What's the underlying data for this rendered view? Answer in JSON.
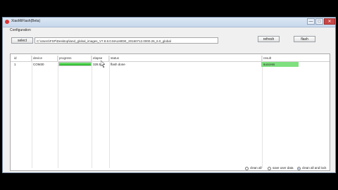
{
  "window": {
    "title": "XiaoMiFlash(Beta)",
    "min_glyph": "—",
    "max_glyph": "□",
    "close_glyph": "✕"
  },
  "config": {
    "label": "Configuration",
    "select_label": "select",
    "path_value": "C:\\Users\\FSP\\Desktop\\land_global_images_V7.8.8.0.MALMIDE_20160712.0000.26_6.0_global",
    "refresh_label": "refresh",
    "flash_label": "flash"
  },
  "table": {
    "columns": [
      "id",
      "device",
      "progress",
      "elapse",
      "status",
      "result"
    ],
    "rows": [
      {
        "id": "1",
        "device": "COM30",
        "progress_fraction": 1.0,
        "elapse": "328.57",
        "status": "flash done",
        "result": "success"
      }
    ]
  },
  "footer": {
    "options": [
      {
        "label": "clean all",
        "selected": false
      },
      {
        "label": "save user data",
        "selected": false
      },
      {
        "label": "clean all and lock",
        "selected": true
      }
    ]
  }
}
